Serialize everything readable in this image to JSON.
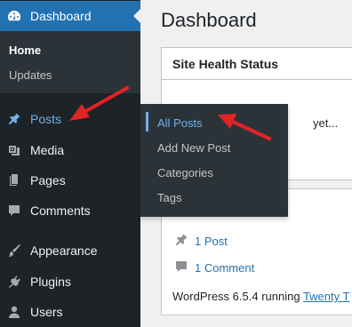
{
  "sidebar": {
    "dashboard_label": "Dashboard",
    "submenu": {
      "home": "Home",
      "updates": "Updates"
    },
    "items": [
      {
        "label": "Posts",
        "icon": "pin-icon"
      },
      {
        "label": "Media",
        "icon": "media-icon"
      },
      {
        "label": "Pages",
        "icon": "pages-icon"
      },
      {
        "label": "Comments",
        "icon": "comment-icon"
      },
      {
        "label": "Appearance",
        "icon": "brush-icon"
      },
      {
        "label": "Plugins",
        "icon": "plugin-icon"
      },
      {
        "label": "Users",
        "icon": "user-icon"
      }
    ]
  },
  "flyout": {
    "items": [
      "All Posts",
      "Add New Post",
      "Categories",
      "Tags"
    ],
    "active": "All Posts"
  },
  "main": {
    "title": "Dashboard",
    "site_health": {
      "title": "Site Health Status",
      "body_fragment": "yet..."
    },
    "glance": {
      "posts": "1 Post",
      "comments": "1 Comment",
      "version_text": "WordPress 6.5.4 running ",
      "theme_link": "Twenty T"
    }
  },
  "colors": {
    "sidebar_bg": "#1d2327",
    "accent": "#2271b1",
    "highlight": "#72aee6",
    "annotation": "#e02424"
  }
}
